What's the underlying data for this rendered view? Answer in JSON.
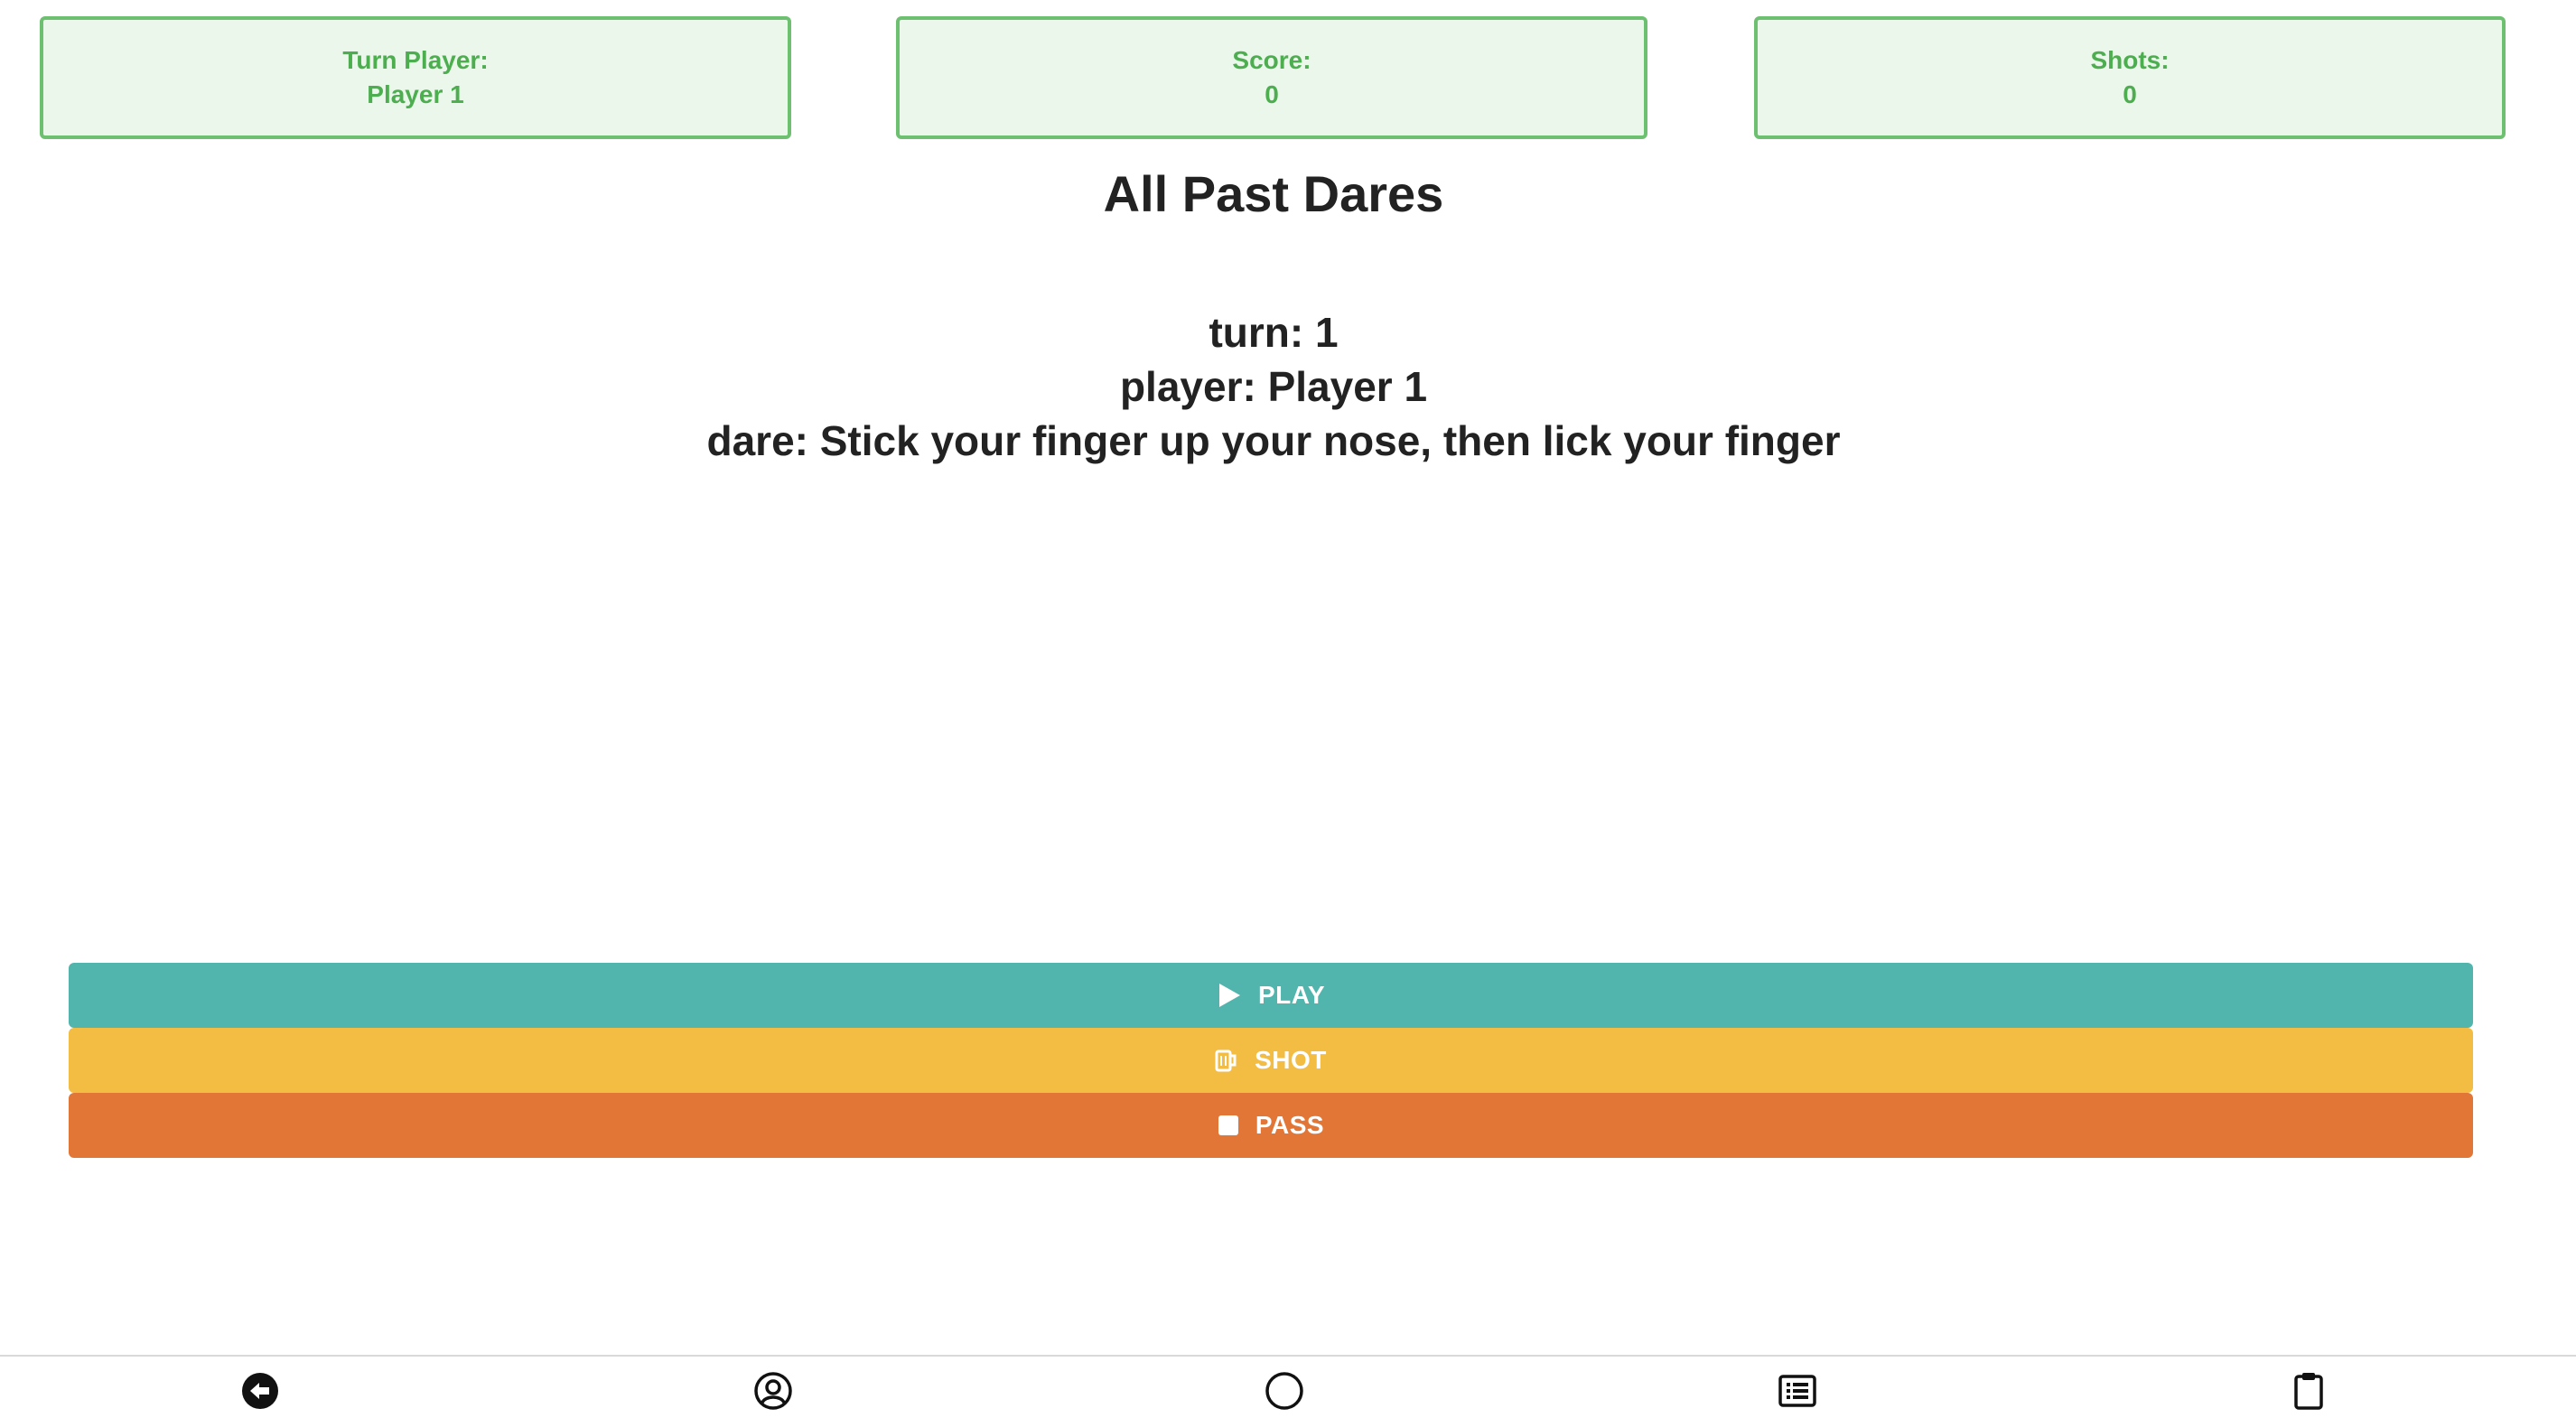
{
  "stats": {
    "turn_player_label": "Turn Player:",
    "turn_player_value": "Player 1",
    "score_label": "Score:",
    "score_value": "0",
    "shots_label": "Shots:",
    "shots_value": "0"
  },
  "title": "All Past Dares",
  "dare": {
    "turn": "turn: 1",
    "player": "player: Player 1",
    "text": "dare: Stick your finger up your nose, then lick your finger"
  },
  "actions": {
    "play_label": "PLAY",
    "shot_label": "SHOT",
    "pass_label": "PASS"
  },
  "icons": {
    "play": "play-icon",
    "shot": "beer-mug-icon",
    "pass": "stop-icon",
    "back": "back-arrow-icon",
    "profile": "user-circle-icon",
    "home": "home-circle-icon",
    "list": "list-icon",
    "clipboard": "clipboard-icon"
  },
  "colors": {
    "stat_border": "#6cc070",
    "stat_background": "#eaf7ea",
    "stat_text": "#4cae4f",
    "play": "#52b5ad",
    "shot": "#f2bd42",
    "pass": "#e27636"
  }
}
